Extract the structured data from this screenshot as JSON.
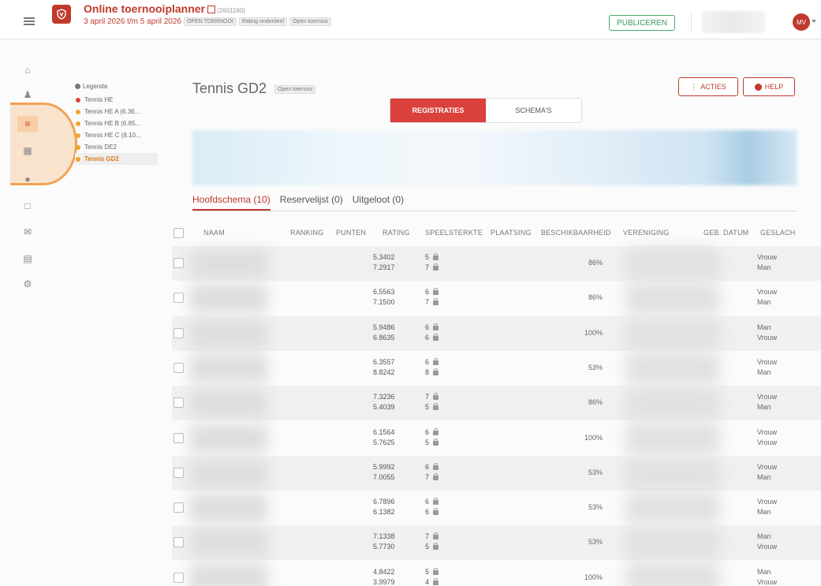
{
  "header": {
    "app_title": "Online toernooiplanner",
    "tournament_id": "(2601160)",
    "date_range": "3 april 2026 t/m 5 april 2026",
    "tags": [
      "OPEN TOERNOOI",
      "Rating onderdeel",
      "Open toernooi"
    ],
    "publish_label": "PUBLICEREN",
    "avatar_initials": "MV"
  },
  "rail_icons": [
    "home-icon",
    "users-icon",
    "list-icon",
    "bracket-icon",
    "globe-icon",
    "display-icon",
    "mail-icon",
    "print-icon",
    "settings-icon"
  ],
  "legend": {
    "title": "Legenda",
    "items": [
      {
        "label": "Tennis HE",
        "color": "#d9413a"
      },
      {
        "label": "Tennis HE A (6.36...",
        "color": "#f0a52b"
      },
      {
        "label": "Tennis HE B (6.85...",
        "color": "#f0a52b"
      },
      {
        "label": "Tennis HE C (8.10...",
        "color": "#f0a52b"
      },
      {
        "label": "Tennis DE2",
        "color": "#f0a52b"
      },
      {
        "label": "Tennis GD2",
        "color": "#f0a52b"
      }
    ]
  },
  "main": {
    "title": "Tennis GD2",
    "tag": "Open toernooi",
    "acties_label": "ACTIES",
    "help_label": "HELP",
    "toggle": [
      "REGISTRATIES",
      "SCHEMA'S"
    ],
    "subtabs": [
      "Hoofdschema (10)",
      "Reservelijst (0)",
      "Uitgeloot (0)"
    ]
  },
  "table": {
    "columns": [
      "NAAM",
      "RANKING",
      "PUNTEN",
      "RATING",
      "SPEELSTERKTE",
      "PLAATSING",
      "BESCHIKBAARHEID",
      "VERENIGING",
      "GEB. DATUM",
      "GESLACH"
    ],
    "rows": [
      {
        "rating": [
          "5.3402",
          "7.2917"
        ],
        "sterkte": [
          "5",
          "7"
        ],
        "beschikbaarheid": "86%",
        "geslacht": [
          "Vrouw",
          "Man"
        ]
      },
      {
        "rating": [
          "6.5563",
          "7.1500"
        ],
        "sterkte": [
          "6",
          "7"
        ],
        "beschikbaarheid": "86%",
        "geslacht": [
          "Vrouw",
          "Man"
        ]
      },
      {
        "rating": [
          "5.9486",
          "6.8635"
        ],
        "sterkte": [
          "6",
          "6"
        ],
        "beschikbaarheid": "100%",
        "geslacht": [
          "Man",
          "Vrouw"
        ]
      },
      {
        "rating": [
          "6.3557",
          "8.8242"
        ],
        "sterkte": [
          "6",
          "8"
        ],
        "beschikbaarheid": "53%",
        "geslacht": [
          "Vrouw",
          "Man"
        ]
      },
      {
        "rating": [
          "7.3236",
          "5.4039"
        ],
        "sterkte": [
          "7",
          "5"
        ],
        "beschikbaarheid": "86%",
        "geslacht": [
          "Vrouw",
          "Man"
        ]
      },
      {
        "rating": [
          "6.1564",
          "5.7625"
        ],
        "sterkte": [
          "6",
          "5"
        ],
        "beschikbaarheid": "100%",
        "geslacht": [
          "Vrouw",
          "Vrouw"
        ]
      },
      {
        "rating": [
          "5.9992",
          "7.0055"
        ],
        "sterkte": [
          "6",
          "7"
        ],
        "beschikbaarheid": "53%",
        "geslacht": [
          "Vrouw",
          "Man"
        ]
      },
      {
        "rating": [
          "6.7896",
          "6.1382"
        ],
        "sterkte": [
          "6",
          "6"
        ],
        "beschikbaarheid": "53%",
        "geslacht": [
          "Vrouw",
          "Man"
        ]
      },
      {
        "rating": [
          "7.1338",
          "5.7730"
        ],
        "sterkte": [
          "7",
          "5"
        ],
        "beschikbaarheid": "53%",
        "geslacht": [
          "Man",
          "Vrouw"
        ]
      },
      {
        "rating": [
          "4.8422",
          "3.9979"
        ],
        "sterkte": [
          "5",
          "4"
        ],
        "beschikbaarheid": "100%",
        "geslacht": [
          "Man",
          "Vrouw"
        ]
      }
    ]
  }
}
